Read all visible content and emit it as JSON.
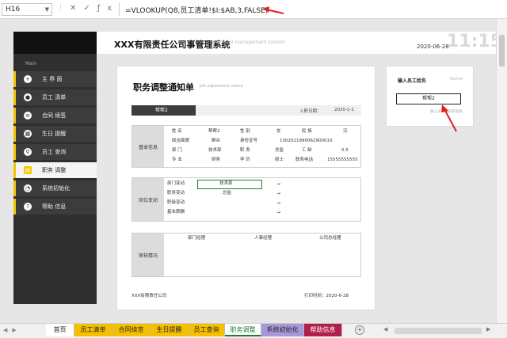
{
  "formula_bar": {
    "cell": "H16",
    "formula": "=VLOOKUP(Q8,员工清单!$I:$AB,3,FALSE)"
  },
  "sidebar": {
    "section": "Main",
    "items": [
      {
        "label": "主 界 面",
        "icon": "plus-icon"
      },
      {
        "label": "员工 清单",
        "icon": "person-icon"
      },
      {
        "label": "合同 续签",
        "icon": "contract-icon"
      },
      {
        "label": "生日 提醒",
        "icon": "calendar-icon"
      },
      {
        "label": "员工 查询",
        "icon": "search-person-icon"
      },
      {
        "label": "职务 调整",
        "icon": "doc-icon",
        "active": true
      },
      {
        "label": "系统初始化",
        "icon": "pie-icon"
      },
      {
        "label": "帮助 信息",
        "icon": "help-icon"
      }
    ]
  },
  "header": {
    "company": "XXX有限责任公司事管理系统",
    "subtitle": "Personnel management system",
    "date": "2020-06-28",
    "clock": "11:15"
  },
  "notice": {
    "title": "职务调整通知单",
    "subtitle": "Job adjustment notice",
    "employee_name": "帮帮2",
    "join_date_label": "入职日期：",
    "join_date": "2020-1-1",
    "basic_info_label": "基本信息",
    "basic_rows": [
      [
        "姓    名",
        "帮帮2",
        "性    别",
        "女",
        "民    族",
        "汉"
      ],
      [
        "政治面貌",
        "群众",
        "身份证号",
        "130202199006290001X",
        "",
        ""
      ],
      [
        "部    门",
        "技术部",
        "职    务",
        "总监",
        "工    龄",
        "0.5"
      ],
      [
        "专    业",
        "财务",
        "学    历",
        "硕士",
        "联系电话",
        "15555555555"
      ]
    ],
    "post_change_label": "岗位变动",
    "post_rows": [
      {
        "label": "部门变动",
        "from": "技术部",
        "arrow": "→",
        "to": ""
      },
      {
        "label": "职务变动",
        "from": "总监",
        "arrow": "→",
        "to": ""
      },
      {
        "label": "职级变动",
        "from": "",
        "arrow": "→",
        "to": ""
      },
      {
        "label": "基本薪酬",
        "from": "",
        "arrow": "→",
        "to": ""
      }
    ],
    "approval_label": "审核情况",
    "approval_headers": [
      "部门经理",
      "人事经理",
      "公司总经理"
    ],
    "footer_company": "XXX有限责任公司",
    "print_time_label": "打印时间：",
    "print_time": "2020-6-28"
  },
  "input_panel": {
    "title": "输入员工姓名",
    "name_label": "Name",
    "value": "帮帮2",
    "hint": "输入员工姓名获取值"
  },
  "sheet_tabs": [
    {
      "label": "首页",
      "color": "#ffffff"
    },
    {
      "label": "员工清单",
      "color": "#f6c000"
    },
    {
      "label": "合同续签",
      "color": "#f6c000"
    },
    {
      "label": "生日提醒",
      "color": "#f6c000"
    },
    {
      "label": "员工查询",
      "color": "#f6c000"
    },
    {
      "label": "职务调整",
      "color": "#ffffff",
      "active": true
    },
    {
      "label": "系统初始化",
      "color": "#a898d8"
    },
    {
      "label": "帮助信息",
      "color": "#b0204a"
    }
  ],
  "colors": {
    "accent": "#f3c400",
    "annotation_arrow": "#e02020",
    "selection": "#1e7a36"
  }
}
